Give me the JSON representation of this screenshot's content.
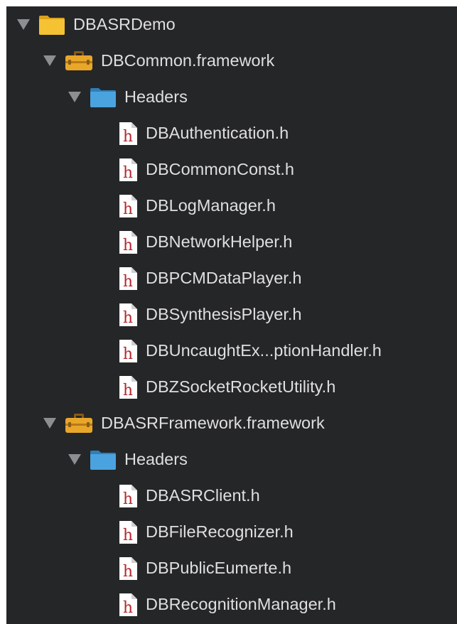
{
  "project_navigator": {
    "root": {
      "name": "DBASRDemo",
      "icon": "yellow-folder-icon",
      "expanded": true
    },
    "frameworks": [
      {
        "name": "DBCommon.framework",
        "icon": "toolbox-icon",
        "expanded": true,
        "group": {
          "name": "Headers",
          "icon": "blue-folder-icon",
          "expanded": true
        },
        "files": [
          "DBAuthentication.h",
          "DBCommonConst.h",
          "DBLogManager.h",
          "DBNetworkHelper.h",
          "DBPCMDataPlayer.h",
          "DBSynthesisPlayer.h",
          "DBUncaughtEx...ptionHandler.h",
          "DBZSocketRocketUtility.h"
        ]
      },
      {
        "name": "DBASRFramework.framework",
        "icon": "toolbox-icon",
        "expanded": true,
        "group": {
          "name": "Headers",
          "icon": "blue-folder-icon",
          "expanded": true
        },
        "files": [
          "DBASRClient.h",
          "DBFileRecognizer.h",
          "DBPublicEumerte.h",
          "DBRecognitionManager.h"
        ]
      }
    ],
    "file_icon": "header-file-icon",
    "file_icon_glyph": "h"
  },
  "colors": {
    "background": "#252628",
    "text": "#dfdfe1",
    "disclosure": "#8d8e91",
    "folder_yellow": "#f4c232",
    "folder_blue": "#4aa3df",
    "toolbox": "#e9a72a",
    "header_file_letter": "#b3272d"
  }
}
